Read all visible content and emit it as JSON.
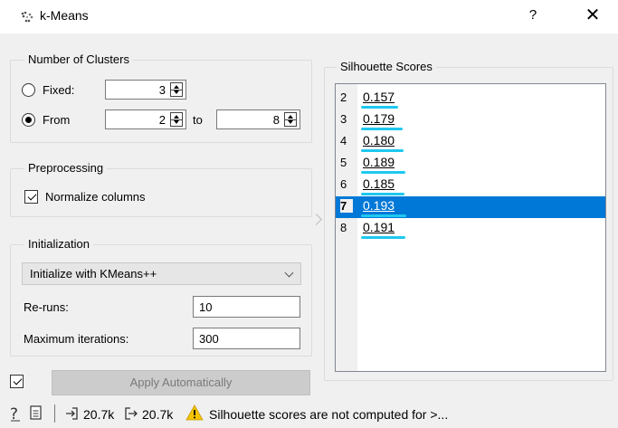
{
  "window": {
    "title": "k-Means",
    "help_label": "?",
    "close_label": "✕"
  },
  "clusters": {
    "group_title": "Number of Clusters",
    "fixed_label": "Fixed:",
    "fixed_value": "3",
    "from_label": "From",
    "from_value": "2",
    "to_label": "to",
    "to_value": "8",
    "selected_option": "From"
  },
  "preprocessing": {
    "group_title": "Preprocessing",
    "normalize_label": "Normalize columns",
    "normalize_checked": true
  },
  "initialization": {
    "group_title": "Initialization",
    "method": "Initialize with KMeans++",
    "reruns_label": "Re-runs:",
    "reruns_value": "10",
    "max_iter_label": "Maximum iterations:",
    "max_iter_value": "300"
  },
  "apply": {
    "label": "Apply Automatically",
    "auto_checked": true
  },
  "silhouette": {
    "title": "Silhouette Scores",
    "rows": [
      {
        "k": "2",
        "score": "0.157",
        "value": 0.157
      },
      {
        "k": "3",
        "score": "0.179",
        "value": 0.179
      },
      {
        "k": "4",
        "score": "0.180",
        "value": 0.18
      },
      {
        "k": "5",
        "score": "0.189",
        "value": 0.189
      },
      {
        "k": "6",
        "score": "0.185",
        "value": 0.185
      },
      {
        "k": "7",
        "score": "0.193",
        "value": 0.193
      },
      {
        "k": "8",
        "score": "0.191",
        "value": 0.191
      }
    ],
    "selected_k": "7"
  },
  "status": {
    "input_count": "20.7k",
    "output_count": "20.7k",
    "warning": "Silhouette scores are not computed for >..."
  },
  "colors": {
    "accent": "#0078d7",
    "score_bar": "#1ec8f0",
    "warning": "#f5c400"
  },
  "icons": [
    "app-icon",
    "help-icon",
    "close-icon",
    "report-icon",
    "input-icon",
    "output-icon",
    "warning-icon"
  ]
}
